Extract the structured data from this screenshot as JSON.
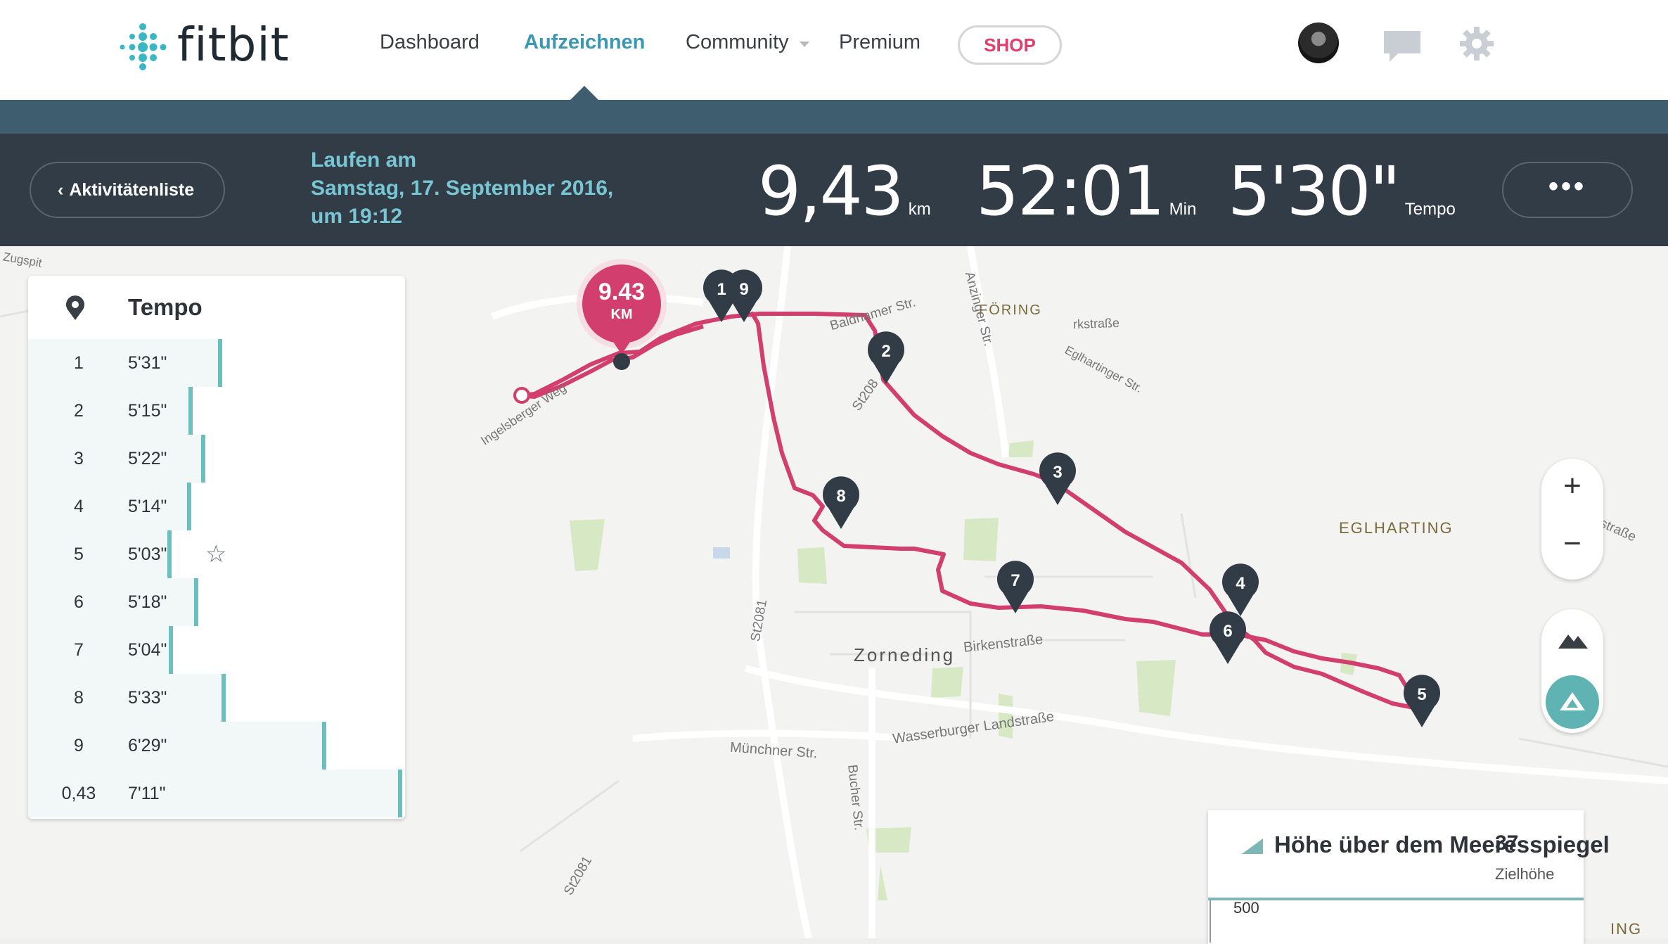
{
  "nav": {
    "logo_text": "fitbit",
    "items": [
      "Dashboard",
      "Aufzeichnen",
      "Community",
      "Premium"
    ],
    "active": "Aufzeichnen",
    "shop_label": "SHOP"
  },
  "header": {
    "back_label": "Aktivitätenliste",
    "title_line1": "Laufen am",
    "title_line2": "Samstag, 17. September 2016,",
    "title_line3": "um 19:12",
    "distance_value": "9,43",
    "distance_unit": "km",
    "duration_value": "52:01",
    "duration_unit": "Min",
    "pace_value": "5'30\"",
    "pace_unit": "Tempo",
    "more_label": "•••"
  },
  "pace_panel": {
    "title": "Tempo",
    "rows": [
      {
        "km": "1",
        "pace": "5'31\"",
        "seconds": 331,
        "best": false
      },
      {
        "km": "2",
        "pace": "5'15\"",
        "seconds": 315,
        "best": false
      },
      {
        "km": "3",
        "pace": "5'22\"",
        "seconds": 322,
        "best": false
      },
      {
        "km": "4",
        "pace": "5'14\"",
        "seconds": 314,
        "best": false
      },
      {
        "km": "5",
        "pace": "5'03\"",
        "seconds": 303,
        "best": true
      },
      {
        "km": "6",
        "pace": "5'18\"",
        "seconds": 318,
        "best": false
      },
      {
        "km": "7",
        "pace": "5'04\"",
        "seconds": 304,
        "best": false
      },
      {
        "km": "8",
        "pace": "5'33\"",
        "seconds": 333,
        "best": false
      },
      {
        "km": "9",
        "pace": "6'29\"",
        "seconds": 389,
        "best": false
      },
      {
        "km": "0,43",
        "pace": "7'11\"",
        "seconds": 431,
        "best": false
      }
    ]
  },
  "map": {
    "end_marker_value": "9.43",
    "end_marker_unit": "KM",
    "route_color": "#d23f6e",
    "km_markers": [
      "1",
      "9",
      "2",
      "3",
      "8",
      "7",
      "4",
      "6",
      "5"
    ],
    "labels": {
      "zorneding": "Zorneding",
      "foering": "FÖRING",
      "eglharting": "EGLHARTING",
      "birkenstrasse": "Birkenstraße",
      "wasserburger": "Wasserburger Landstraße",
      "muenchner": "Münchner Str.",
      "baldhamer": "Baldhamer Str.",
      "anzinger": "Anzinger Str.",
      "ingelsberger": "Ingelsberger Weg",
      "bucher": "Bucher Str.",
      "st2081a": "St2081",
      "st2081b": "St2081",
      "st2080": "St208",
      "hubertus": "Hubertusstraße",
      "parkstrasse": "rkstraße",
      "eglhartinger": "Eglhartinger Str.",
      "zugspitz": "Zugspit",
      "ing": "ING"
    },
    "zoom_in": "+",
    "zoom_out": "−"
  },
  "elevation": {
    "title": "Höhe über dem Meeresspiegel",
    "value_overlap": "37",
    "sub_label": "Zielhöhe",
    "axis_tick": "500"
  },
  "colors": {
    "accent": "#3b97b3",
    "header_bg": "#323c46",
    "subbar_bg": "#3e5d6f",
    "shop": "#e03e6b",
    "pace_bar": "#6bbfbf",
    "marker": "#323c46"
  }
}
